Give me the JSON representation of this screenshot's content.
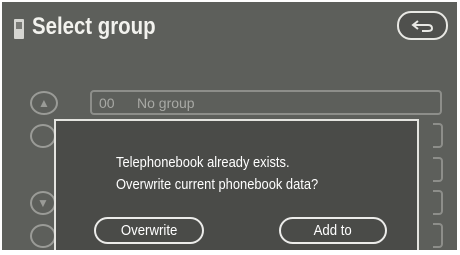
{
  "header": {
    "title": "Select group"
  },
  "groups": [
    {
      "number": "00",
      "name": "No group"
    }
  ],
  "dialog": {
    "message_line1": "Telephonebook already exists.",
    "message_line2": "Overwrite current phonebook data?",
    "overwrite_label": "Overwrite",
    "add_label": "Add to"
  },
  "icons": {
    "back": "back-arrow-icon",
    "scroll_up": "scroll-up-icon",
    "scroll_down": "scroll-down-icon",
    "header": "phonebook-icon"
  }
}
